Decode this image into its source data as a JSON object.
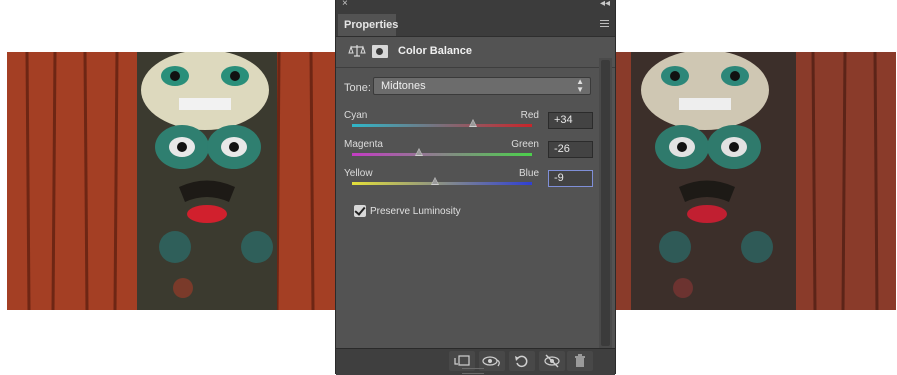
{
  "panel": {
    "close_glyph": "×",
    "collapse_glyph": "◂◂",
    "tab_label": "Properties",
    "adjustment_title": "Color Balance",
    "tone": {
      "label": "Tone:",
      "value": "Midtones"
    },
    "sliders": [
      {
        "left": "Cyan",
        "right": "Red",
        "value": "+34",
        "fraction": 0.67
      },
      {
        "left": "Magenta",
        "right": "Green",
        "value": "-26",
        "fraction": 0.37
      },
      {
        "left": "Yellow",
        "right": "Blue",
        "value": "-9",
        "fraction": 0.46
      }
    ],
    "preserve_luminosity": {
      "label": "Preserve Luminosity",
      "checked": true
    },
    "bottom_icons": [
      "clip-to-layer-icon",
      "view-previous-state-icon",
      "reset-icon",
      "toggle-visibility-icon",
      "delete-icon"
    ]
  },
  "colors": {
    "panel_bg": "#535353",
    "cyan": "#2fb7c9",
    "red": "#c8252a",
    "magenta": "#c43cc4",
    "green": "#4bd14b",
    "yellow": "#e4e03a",
    "blue": "#2f3fd4"
  }
}
